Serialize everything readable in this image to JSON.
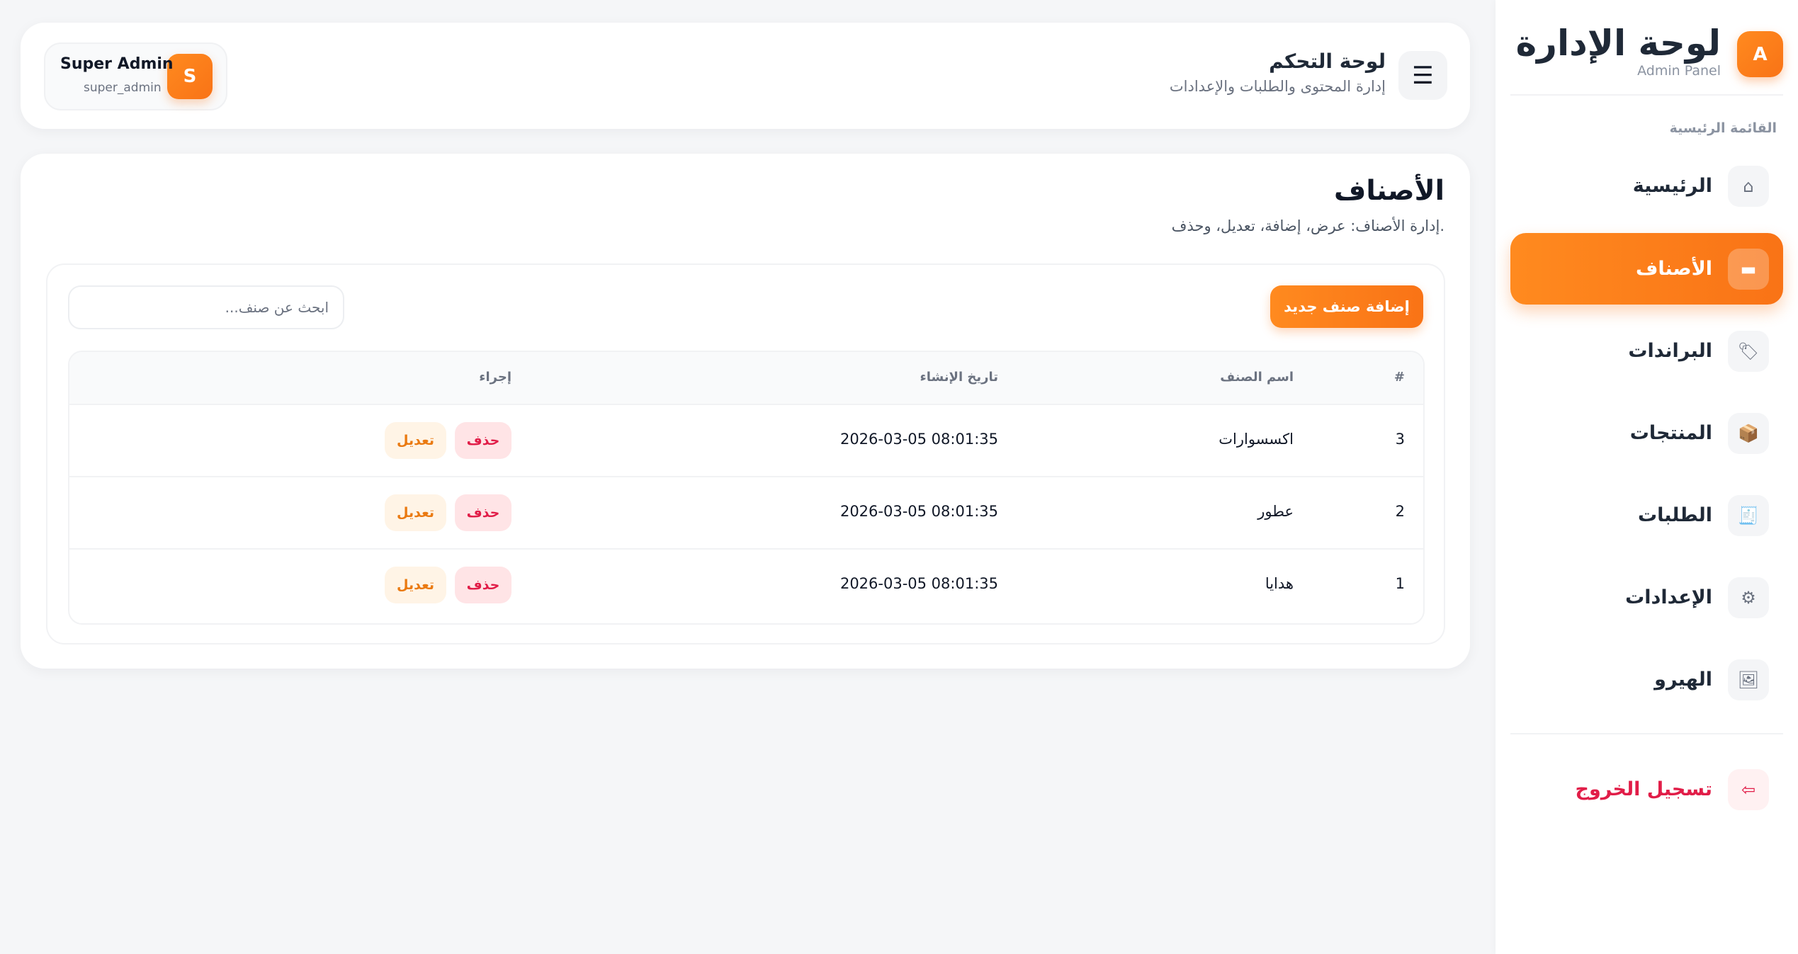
{
  "sidebar": {
    "brand_badge": "A",
    "brand_title": "لوحة الإدارة",
    "brand_subtitle": "Admin Panel",
    "menu_heading": "القائمة الرئيسية",
    "items": [
      {
        "label": "الرئيسية",
        "icon": "⌂",
        "icon_name": "home-icon",
        "active": false
      },
      {
        "label": "الأصناف",
        "icon": "▬",
        "icon_name": "folder-icon",
        "active": true
      },
      {
        "label": "البراندات",
        "icon": "🏷",
        "icon_name": "tag-icon",
        "active": false
      },
      {
        "label": "المنتجات",
        "icon": "📦",
        "icon_name": "box-icon",
        "active": false
      },
      {
        "label": "الطلبات",
        "icon": "🧾",
        "icon_name": "receipt-icon",
        "active": false
      },
      {
        "label": "الإعدادات",
        "icon": "⚙",
        "icon_name": "gear-icon",
        "active": false
      },
      {
        "label": "الهيرو",
        "icon": "🖼",
        "icon_name": "image-icon",
        "active": false
      }
    ],
    "logout": {
      "label": "تسجيل الخروج",
      "icon": "⇦",
      "icon_name": "logout-icon"
    }
  },
  "header": {
    "menu_icon": "☰",
    "title": "لوحة التحكم",
    "subtitle": "إدارة المحتوى والطلبات والإعدادات",
    "user": {
      "avatar": "S",
      "name": "Super Admin",
      "handle": "super_admin"
    }
  },
  "main": {
    "title": "الأصناف",
    "subtitle": "إدارة الأصناف: عرض، إضافة، تعديل، وحذف.",
    "add_button": "إضافة صنف جديد",
    "search": {
      "value": "",
      "placeholder": "ابحث عن صنف..."
    },
    "table": {
      "headers": {
        "num": "#",
        "name": "اسم الصنف",
        "date": "تاريخ الإنشاء",
        "actions": "إجراء"
      },
      "rows": [
        {
          "num": "3",
          "name": "اكسسوارات",
          "date": "2026-03-05 08:01:35",
          "edit": "تعديل",
          "delete": "حذف"
        },
        {
          "num": "2",
          "name": "عطور",
          "date": "2026-03-05 08:01:35",
          "edit": "تعديل",
          "delete": "حذف"
        },
        {
          "num": "1",
          "name": "هدايا",
          "date": "2026-03-05 08:01:35",
          "edit": "تعديل",
          "delete": "حذف"
        }
      ]
    }
  },
  "colors": {
    "accent": "#f97316",
    "danger": "#e11d48",
    "background": "#f5f6f8"
  }
}
